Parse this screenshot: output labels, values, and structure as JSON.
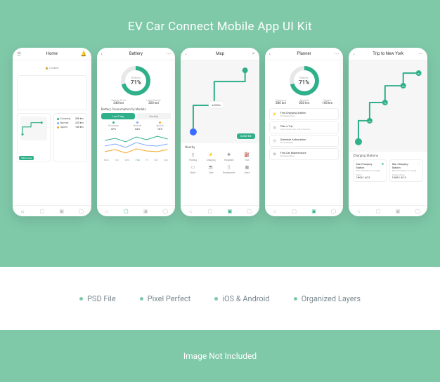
{
  "colors": {
    "brand": "#7fc9a9",
    "accent": "#2fb08a",
    "blue": "#7aa9ff",
    "orange": "#f5a623"
  },
  "title": "EV Car Connect Mobile App UI Kit",
  "features": [
    "PSD File",
    "Pixel Perfect",
    "iOS & Android",
    "Organized Layers"
  ],
  "footer_note": "Image Not Included",
  "screens": {
    "home": {
      "title": "Home",
      "lock_status": "🔒  Locked",
      "away_badge": "500m away",
      "modes": [
        {
          "name": "Economy",
          "value": "280 km"
        },
        {
          "name": "Normal",
          "value": "220 km"
        },
        {
          "name": "Sports",
          "value": "160 km"
        }
      ]
    },
    "battery": {
      "title": "Battery",
      "donut_label": "Battery",
      "donut_value": "71%",
      "stats": [
        {
          "label": "Able to Drive",
          "value": "340 km"
        },
        {
          "label": "Last Charge",
          "value": "320 km"
        }
      ],
      "section": "Battery Consumption by Modals",
      "pills": [
        "Last 7 day",
        "Monthly"
      ],
      "modals": [
        {
          "name": "Economy",
          "pct": "47%"
        },
        {
          "name": "Normal",
          "pct": "34%"
        },
        {
          "name": "Sports",
          "pct": "18%"
        }
      ],
      "days": [
        "Mon",
        "Tue",
        "Wed",
        "Thu",
        "Fri",
        "Sat",
        "Sun"
      ],
      "today_index": 3
    },
    "map": {
      "title": "Map",
      "car_badge": "500m",
      "guide_btn": "GUIDE ME",
      "section": "Nearby",
      "items": [
        "Parking",
        "Charging",
        "Hospitals",
        "Fuel",
        "Malls",
        "Cafe",
        "Restaurants",
        "More"
      ]
    },
    "planner": {
      "title": "Planner",
      "donut_label": "Battery",
      "donut_value": "71%",
      "stats": [
        {
          "label": "Economy",
          "value": "280 km"
        },
        {
          "label": "Normal",
          "value": "220 km"
        },
        {
          "label": "Sports",
          "value": "160 km"
        }
      ],
      "items": [
        {
          "title": "Find Charging Station",
          "sub": "No Reservation"
        },
        {
          "title": "Plan a Trip",
          "sub": "Trip to New York, Trip to Florida"
        },
        {
          "title": "Schedule Automation",
          "sub": "No Schedules"
        },
        {
          "title": "Find Car Maintenance",
          "sub": "No Reservation"
        }
      ]
    },
    "trip": {
      "title": "Trip to New York",
      "section": "Charging Stations",
      "cards": [
        {
          "name": "Star Charging Station",
          "sub": "88% estimated car charge",
          "type": "Type 1",
          "power": "14KW / AC-3",
          "fav": true
        },
        {
          "name": "Star Charging Station",
          "sub": "88% estimated car charge",
          "type": "Amazon Plug",
          "power": "14KW / AC-3",
          "fav": false
        }
      ]
    }
  },
  "chart_data": {
    "type": "line",
    "title": "Battery Consumption by Modals",
    "categories": [
      "Mon",
      "Tue",
      "Wed",
      "Thu",
      "Fri",
      "Sat",
      "Sun"
    ],
    "series": [
      {
        "name": "Economy",
        "color": "#2fb08a",
        "values": [
          42,
          46,
          40,
          48,
          44,
          50,
          45
        ]
      },
      {
        "name": "Normal",
        "color": "#7aa9ff",
        "values": [
          30,
          34,
          28,
          36,
          32,
          30,
          34
        ]
      },
      {
        "name": "Sports",
        "color": "#f5a623",
        "values": [
          16,
          20,
          14,
          22,
          18,
          16,
          20
        ]
      }
    ],
    "ylim": [
      0,
      60
    ]
  }
}
